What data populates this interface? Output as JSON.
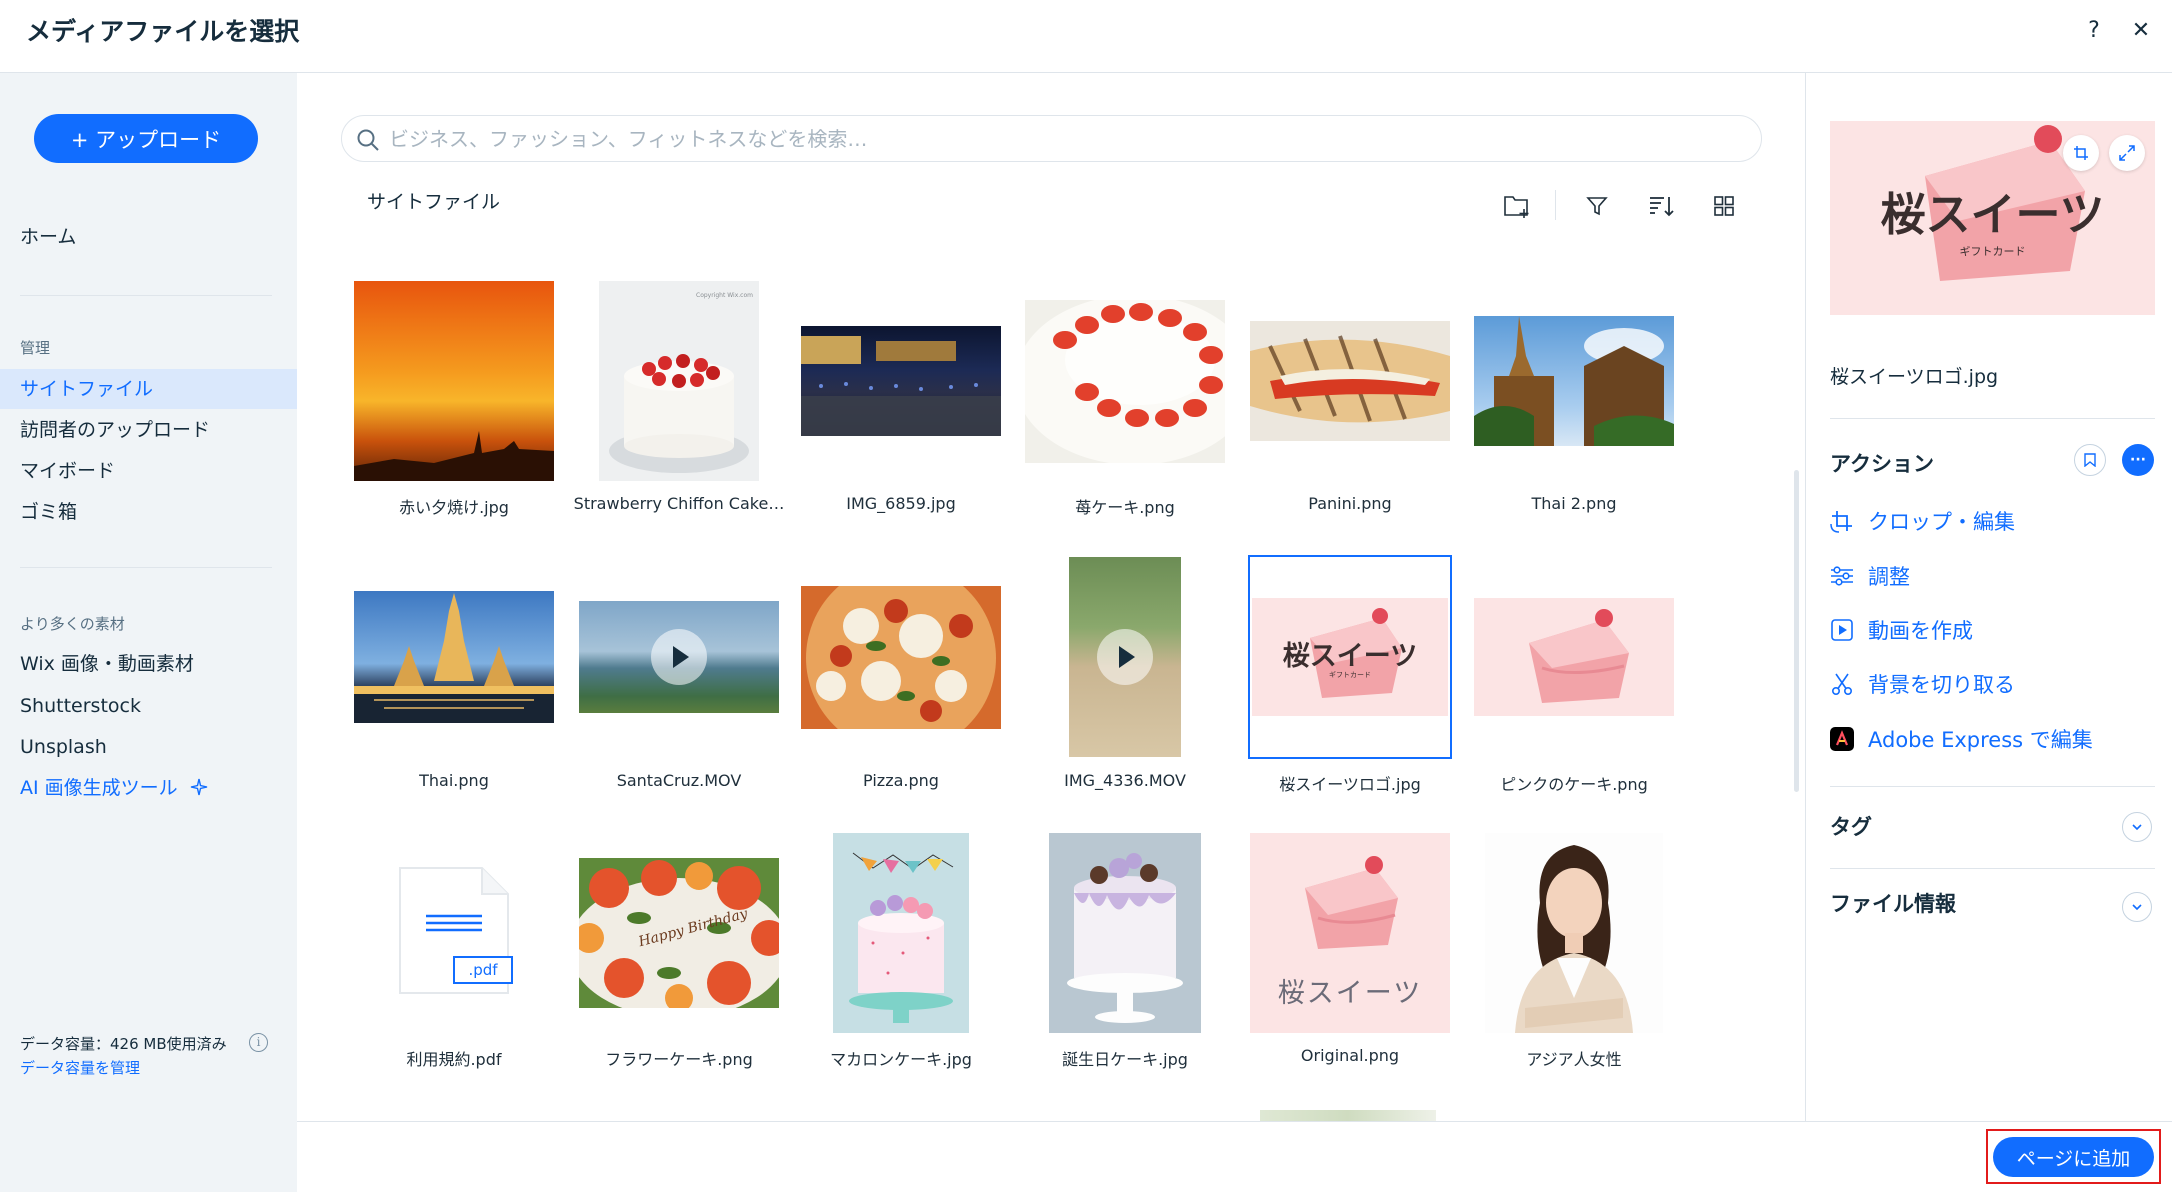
{
  "header": {
    "title": "メディアファイルを選択",
    "help": "?",
    "close": "✕"
  },
  "sidebar": {
    "upload_label": "+ アップロード",
    "home": "ホーム",
    "manage_heading": "管理",
    "manage_items": [
      "サイトファイル",
      "訪問者のアップロード",
      "マイボード",
      "ゴミ箱"
    ],
    "more_heading": "より多くの素材",
    "more_items": [
      "Wix 画像・動画素材",
      "Shutterstock",
      "Unsplash",
      "AI 画像生成ツール"
    ],
    "storage_label": "データ容量：426 MB使用済み",
    "storage_info": "i",
    "storage_manage": "データ容量を管理"
  },
  "search": {
    "placeholder": "ビジネス、ファッション、フィットネスなどを検索…"
  },
  "section_title": "サイトファイル",
  "files": [
    {
      "name": "赤い夕焼け.jpg",
      "type": "image"
    },
    {
      "name": "Strawberry Chiffon Cake…",
      "type": "image"
    },
    {
      "name": "IMG_6859.jpg",
      "type": "image"
    },
    {
      "name": "苺ケーキ.png",
      "type": "image"
    },
    {
      "name": "Panini.png",
      "type": "image"
    },
    {
      "name": "Thai 2.png",
      "type": "image"
    },
    {
      "name": "Thai.png",
      "type": "image"
    },
    {
      "name": "SantaCruz.MOV",
      "type": "video"
    },
    {
      "name": "Pizza.png",
      "type": "image"
    },
    {
      "name": "IMG_4336.MOV",
      "type": "video"
    },
    {
      "name": "桜スイーツロゴ.jpg",
      "type": "image",
      "selected": true
    },
    {
      "name": "ピンクのケーキ.png",
      "type": "image"
    },
    {
      "name": "利用規約.pdf",
      "type": "pdf"
    },
    {
      "name": "フラワーケーキ.png",
      "type": "image"
    },
    {
      "name": "マカロンケーキ.jpg",
      "type": "image"
    },
    {
      "name": "誕生日ケーキ.jpg",
      "type": "image"
    },
    {
      "name": "Original.png",
      "type": "image"
    },
    {
      "name": "アジア人女性",
      "type": "image"
    }
  ],
  "thumb_text": {
    "logo_main": "桜スイーツ",
    "logo_sub": "ギフトカード",
    "pdf_badge": ".pdf",
    "cake_caption_1": "Copyright Wix.com",
    "birthday": "Happy Birthday"
  },
  "right_panel": {
    "file_name": "桜スイーツロゴ.jpg",
    "actions_heading": "アクション",
    "more": "···",
    "actions": [
      "クロップ・編集",
      "調整",
      "動画を作成",
      "背景を切り取る",
      "Adobe Express で編集"
    ],
    "tags_heading": "タグ",
    "file_info_heading": "ファイル情報"
  },
  "footer": {
    "add_label": "ページに追加"
  },
  "colors": {
    "accent": "#116dff",
    "sidebar_bg": "#f0f4f7",
    "highlight": "#e21b1b"
  }
}
